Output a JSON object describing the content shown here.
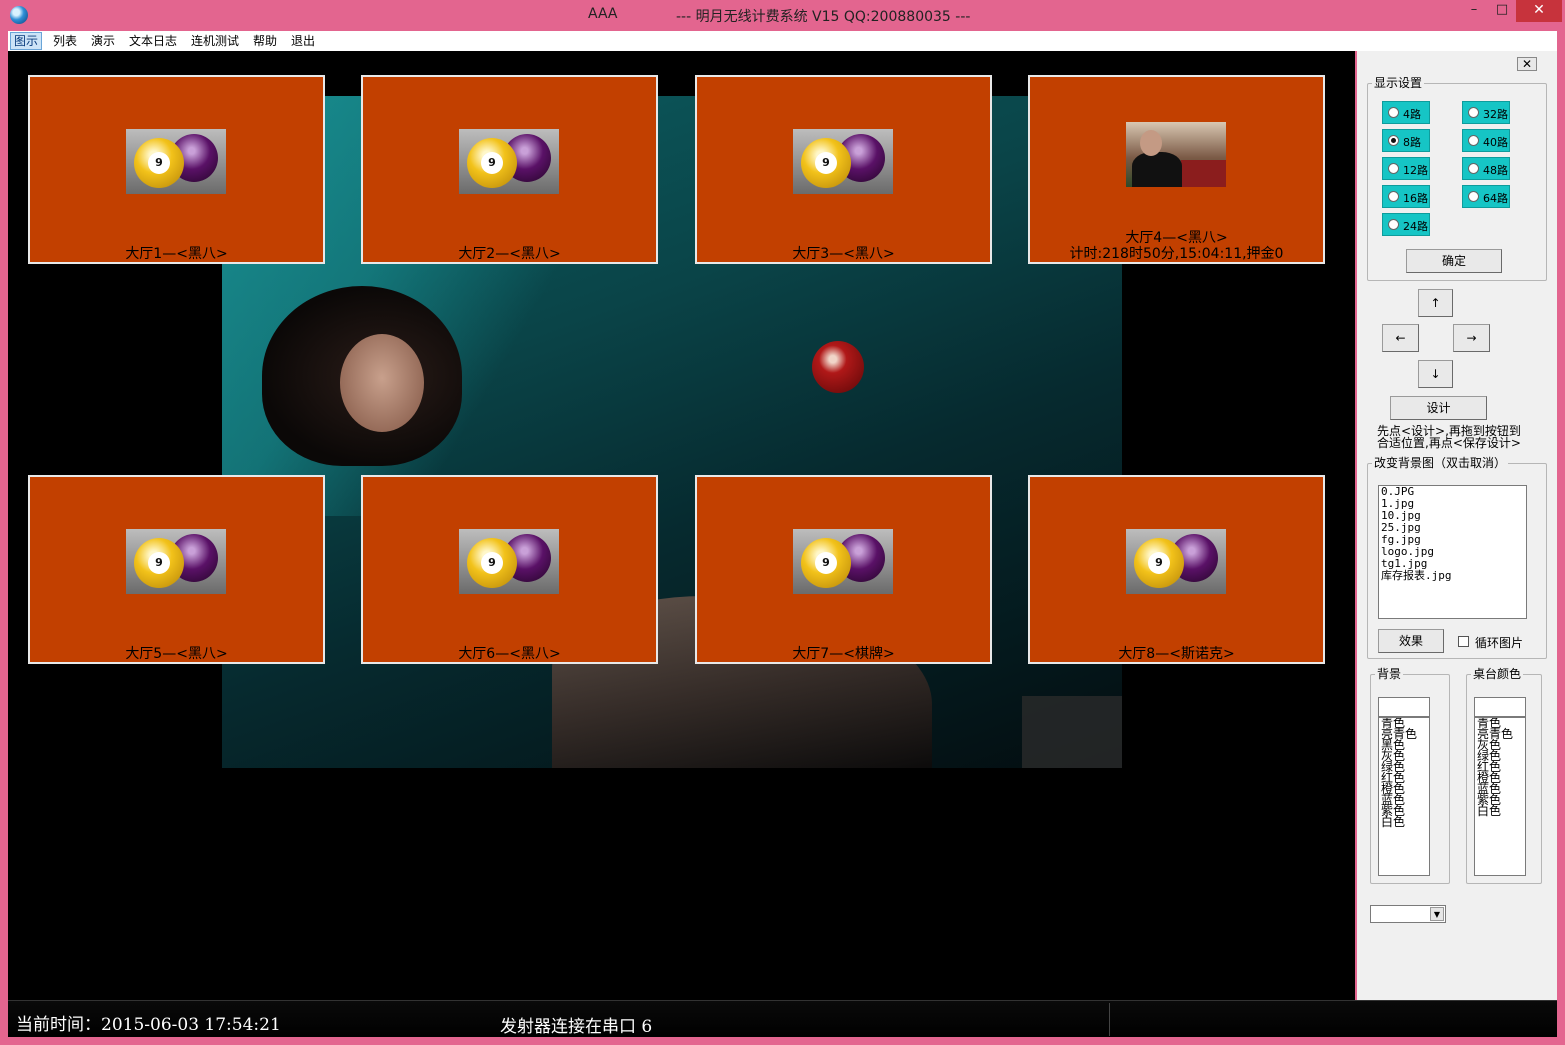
{
  "window": {
    "app_name": "AAA",
    "title": "--- 明月无线计费系统 V15  QQ:200880035 ---",
    "min": "–",
    "max": "□",
    "close": "✕"
  },
  "menu": [
    "图示",
    "列表",
    "演示",
    "文本日志",
    "连机测试",
    "帮助",
    "退出"
  ],
  "tiles": [
    {
      "label": "大厅1—<黑八>",
      "thumb": "billiard-balls",
      "ball_number": "9"
    },
    {
      "label": "大厅2—<黑八>",
      "thumb": "billiard-balls",
      "ball_number": "9"
    },
    {
      "label": "大厅3—<黑八>",
      "thumb": "billiard-balls",
      "ball_number": "9"
    },
    {
      "label": "大厅4—<黑八>",
      "sub": "计时:218时50分,15:04:11,押金0",
      "thumb": "player-photo"
    },
    {
      "label": "大厅5—<黑八>",
      "thumb": "billiard-balls",
      "ball_number": "9"
    },
    {
      "label": "大厅6—<黑八>",
      "thumb": "billiard-balls",
      "ball_number": "9"
    },
    {
      "label": "大厅7—<棋牌>",
      "thumb": "billiard-balls",
      "ball_number": "9"
    },
    {
      "label": "大厅8—<斯诺克>",
      "thumb": "billiard-balls",
      "ball_number": "9"
    }
  ],
  "panel": {
    "close": "✕",
    "display_settings": {
      "legend": "显示设置",
      "options": [
        {
          "label": "4路",
          "selected": false
        },
        {
          "label": "32路",
          "selected": false
        },
        {
          "label": "8路",
          "selected": true
        },
        {
          "label": "40路",
          "selected": false
        },
        {
          "label": "12路",
          "selected": false
        },
        {
          "label": "48路",
          "selected": false
        },
        {
          "label": "16路",
          "selected": false
        },
        {
          "label": "64路",
          "selected": false
        },
        {
          "label": "24路",
          "selected": false
        }
      ],
      "confirm": "确定"
    },
    "arrows": {
      "up": "↑",
      "left": "←",
      "right": "→",
      "down": "↓"
    },
    "design_button": "设计",
    "hint_line1": "先点<设计>,再拖到按钮到",
    "hint_line2": "合适位置,再点<保存设计>",
    "background_image": {
      "legend": "改变背景图（双击取消）",
      "files": [
        "0.JPG",
        "1.jpg",
        "10.jpg",
        "25.jpg",
        "fg.jpg",
        "logo.jpg",
        "tg1.jpg",
        "库存报表.jpg"
      ],
      "effect_button": "效果",
      "loop_label": "循环图片",
      "loop_checked": false
    },
    "background_color": {
      "legend": "背景",
      "colors": [
        "青色",
        "亮青色",
        "黑色",
        "灰色",
        "绿色",
        "红色",
        "橙色",
        "蓝色",
        "紫色",
        "白色"
      ]
    },
    "table_color": {
      "legend": "桌台颜色",
      "colors": [
        "青色",
        "亮青色",
        "灰色",
        "绿色",
        "红色",
        "橙色",
        "蓝色",
        "紫色",
        "白色"
      ]
    }
  },
  "status": {
    "time_label": "当前时间：2015-06-03 17:54:21",
    "port_label": "发射器连接在串口 6"
  },
  "colors": {
    "frame": "#e3658f",
    "tile": "#c24000",
    "radio": "#16c5c5"
  }
}
